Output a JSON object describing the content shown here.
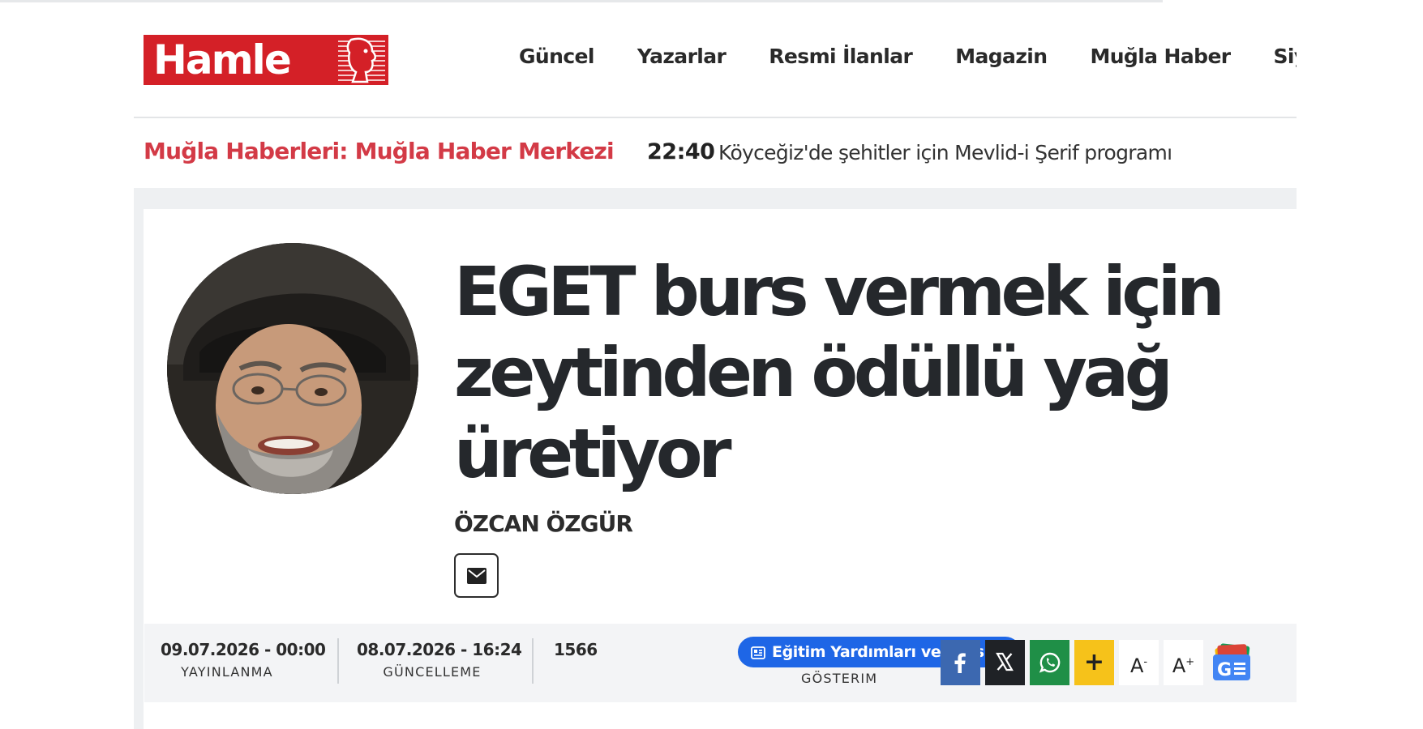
{
  "header": {
    "logo_text": "Hamle",
    "nav": [
      "Güncel",
      "Yazarlar",
      "Resmi İlanlar",
      "Magazin",
      "Muğla Haber",
      "Siyaset"
    ]
  },
  "breaking": {
    "label": "Muğla Haberleri: Muğla Haber Merkezi",
    "time": "22:40",
    "text": "Köyceğiz'de şehitler için Mevlid-i Şerif programı"
  },
  "article": {
    "headline": "EGET burs vermek için zeytinden ödüllü yağ üretiyor",
    "author": "ÖZCAN ÖZGÜR",
    "mail_icon": "envelope-icon"
  },
  "meta": {
    "published_value": "09.07.2026 - 00:00",
    "published_label": "YAYINLANMA",
    "updated_value": "08.07.2026 - 16:24",
    "updated_label": "GÜNCELLEME",
    "views_value": "1566",
    "views_label": "GÖSTERIM",
    "tag": "Eğitim Yardımları ve Burslar"
  },
  "share": {
    "facebook_icon": "facebook-icon",
    "x_icon": "x-icon",
    "whatsapp_icon": "whatsapp-icon",
    "plus_label": "+",
    "font_smaller": "A",
    "font_smaller_sup": "-",
    "font_larger": "A",
    "font_larger_sup": "+",
    "google_news_icon": "google-news-icon"
  },
  "colors": {
    "brand_red": "#d42027",
    "breaking_red": "#d33a46",
    "tag_blue": "#1e66e6",
    "facebook": "#3c68b0",
    "x": "#1f2226",
    "whatsapp": "#1f8f47",
    "plus": "#f6c21a"
  }
}
